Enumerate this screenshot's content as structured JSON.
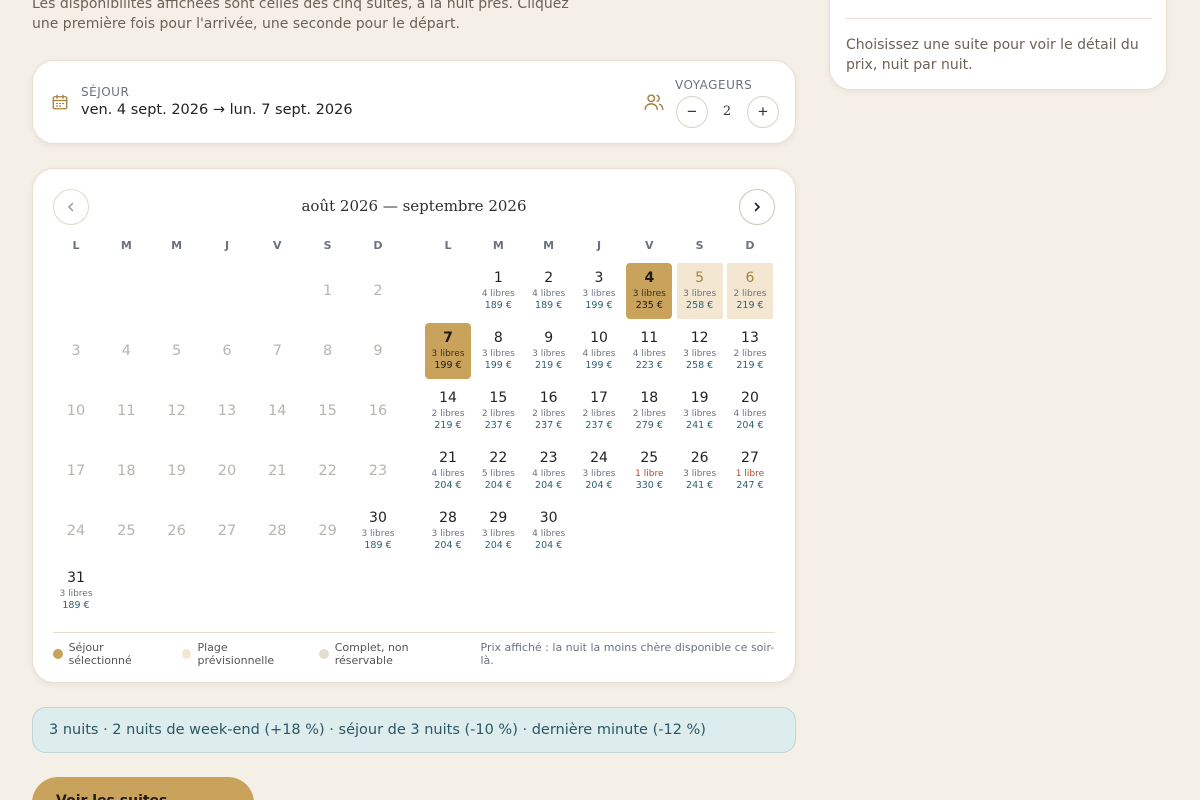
{
  "intro": "Les disponibilités affichées sont celles des cinq suites, à la nuit près. Cliquez une première fois pour l'arrivée, une seconde pour le départ.",
  "stay": {
    "label": "SÉJOUR",
    "value": "ven. 4 sept. 2026 → lun. 7 sept. 2026",
    "guests_label": "VOYAGEURS",
    "guests": "2",
    "minus": "−",
    "plus": "+"
  },
  "calendar": {
    "title": "août 2026 — septembre 2026",
    "weekdays": [
      "L",
      "M",
      "M",
      "J",
      "V",
      "S",
      "D"
    ],
    "months": [
      {
        "name": "août 2026",
        "offset": 5,
        "days": [
          {
            "d": "1",
            "past": true
          },
          {
            "d": "2",
            "past": true
          },
          {
            "d": "3",
            "past": true
          },
          {
            "d": "4",
            "past": true
          },
          {
            "d": "5",
            "past": true
          },
          {
            "d": "6",
            "past": true
          },
          {
            "d": "7",
            "past": true
          },
          {
            "d": "8",
            "past": true
          },
          {
            "d": "9",
            "past": true
          },
          {
            "d": "10",
            "past": true
          },
          {
            "d": "11",
            "past": true
          },
          {
            "d": "12",
            "past": true
          },
          {
            "d": "13",
            "past": true
          },
          {
            "d": "14",
            "past": true
          },
          {
            "d": "15",
            "past": true
          },
          {
            "d": "16",
            "past": true
          },
          {
            "d": "17",
            "past": true
          },
          {
            "d": "18",
            "past": true
          },
          {
            "d": "19",
            "past": true
          },
          {
            "d": "20",
            "past": true
          },
          {
            "d": "21",
            "past": true
          },
          {
            "d": "22",
            "past": true
          },
          {
            "d": "23",
            "past": true
          },
          {
            "d": "24",
            "past": true
          },
          {
            "d": "25",
            "past": true
          },
          {
            "d": "26",
            "past": true
          },
          {
            "d": "27",
            "past": true
          },
          {
            "d": "28",
            "past": true
          },
          {
            "d": "29",
            "past": true
          },
          {
            "d": "30",
            "avail": "3 libres",
            "price": "189 €"
          },
          {
            "d": "31",
            "avail": "3 libres",
            "price": "189 €"
          }
        ]
      },
      {
        "name": "septembre 2026",
        "offset": 1,
        "days": [
          {
            "d": "1",
            "avail": "4 libres",
            "price": "189 €"
          },
          {
            "d": "2",
            "avail": "4 libres",
            "price": "189 €"
          },
          {
            "d": "3",
            "avail": "3 libres",
            "price": "199 €"
          },
          {
            "d": "4",
            "avail": "3 libres",
            "price": "235 €",
            "state": "sel"
          },
          {
            "d": "5",
            "avail": "3 libres",
            "price": "258 €",
            "state": "range"
          },
          {
            "d": "6",
            "avail": "2 libres",
            "price": "219 €",
            "state": "range"
          },
          {
            "d": "7",
            "avail": "3 libres",
            "price": "199 €",
            "state": "sel"
          },
          {
            "d": "8",
            "avail": "3 libres",
            "price": "199 €"
          },
          {
            "d": "9",
            "avail": "3 libres",
            "price": "219 €"
          },
          {
            "d": "10",
            "avail": "4 libres",
            "price": "199 €"
          },
          {
            "d": "11",
            "avail": "4 libres",
            "price": "223 €"
          },
          {
            "d": "12",
            "avail": "3 libres",
            "price": "258 €"
          },
          {
            "d": "13",
            "avail": "2 libres",
            "price": "219 €"
          },
          {
            "d": "14",
            "avail": "2 libres",
            "price": "219 €"
          },
          {
            "d": "15",
            "avail": "2 libres",
            "price": "237 €"
          },
          {
            "d": "16",
            "avail": "2 libres",
            "price": "237 €"
          },
          {
            "d": "17",
            "avail": "2 libres",
            "price": "237 €"
          },
          {
            "d": "18",
            "avail": "2 libres",
            "price": "279 €"
          },
          {
            "d": "19",
            "avail": "3 libres",
            "price": "241 €"
          },
          {
            "d": "20",
            "avail": "4 libres",
            "price": "204 €"
          },
          {
            "d": "21",
            "avail": "4 libres",
            "price": "204 €"
          },
          {
            "d": "22",
            "avail": "5 libres",
            "price": "204 €"
          },
          {
            "d": "23",
            "avail": "4 libres",
            "price": "204 €"
          },
          {
            "d": "24",
            "avail": "3 libres",
            "price": "204 €"
          },
          {
            "d": "25",
            "avail": "1 libre",
            "price": "330 €",
            "low": true
          },
          {
            "d": "26",
            "avail": "3 libres",
            "price": "241 €"
          },
          {
            "d": "27",
            "avail": "1 libre",
            "price": "247 €",
            "low": true
          },
          {
            "d": "28",
            "avail": "3 libres",
            "price": "204 €"
          },
          {
            "d": "29",
            "avail": "3 libres",
            "price": "204 €"
          },
          {
            "d": "30",
            "avail": "4 libres",
            "price": "204 €"
          }
        ]
      }
    ],
    "legend": [
      {
        "label": "Séjour sélectionné",
        "color": "#c9a35c"
      },
      {
        "label": "Plage prévisionnelle",
        "color": "#f4e7d1"
      },
      {
        "label": "Complet, non réservable",
        "color": "#e5ddd0"
      }
    ],
    "legend_note": "Prix affiché : la nuit la moins chère disponible ce soir-là."
  },
  "banner": "3 nuits · 2 nuits de week-end (+18 %) · séjour de 3 nuits (-10 %) · dernière minute (-12 %)",
  "cta": "Voir les suites disponibles",
  "side": {
    "text": "Choisissez une suite pour voir le détail du prix, nuit par nuit."
  },
  "colors": {
    "accent": "#c9a35c",
    "range": "#f4e7d1",
    "price": "#2b6372",
    "low": "#b5492a",
    "background": "#f4efe7"
  }
}
